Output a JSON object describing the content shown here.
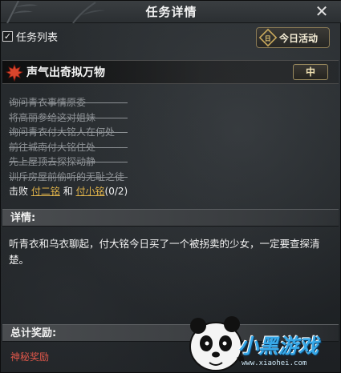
{
  "window": {
    "title": "任务详情"
  },
  "list": {
    "label": "任务列表",
    "checked": true
  },
  "today_button": {
    "label": "今日活动",
    "icon_text": "日"
  },
  "quest": {
    "title": "声气出奇拟万物",
    "difficulty": "中",
    "steps": [
      {
        "text": "询问青衣事情原委",
        "status": "done"
      },
      {
        "text": "将高丽参给这对姐妹",
        "status": "done"
      },
      {
        "text": "询问青衣付大铭人在何处",
        "status": "done"
      },
      {
        "text": "前往城南付大铭住处",
        "status": "done"
      },
      {
        "text": "先上屋顶去探探动静",
        "status": "done"
      },
      {
        "text": "训斥房屋前偷听的无耻之徒",
        "status": "done"
      }
    ],
    "current": {
      "prefix": "击败",
      "target1": "付二铭",
      "conj": "和",
      "target2": "付小铭",
      "progress": "(0/2)"
    }
  },
  "details": {
    "header": "详情:",
    "text": "听青衣和乌衣聊起，付大铭今日买了一个被拐卖的少女，一定要查探清楚。"
  },
  "rewards": {
    "header": "总计奖励:",
    "item": "神秘奖励"
  },
  "watermark": {
    "text": "小黑游戏",
    "url": "www.xiaohei.com"
  },
  "colors": {
    "accent_gold": "#e0b34a",
    "reward_red": "#e0574a",
    "completed_gray": "#8e9296"
  }
}
